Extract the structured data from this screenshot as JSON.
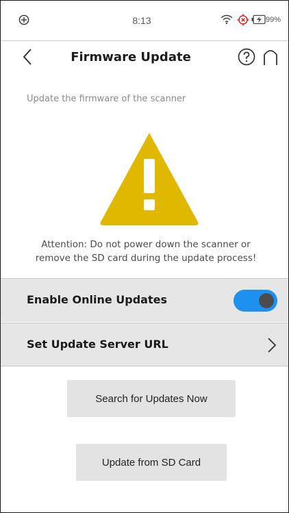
{
  "status_bar": {
    "time": "8:13",
    "battery_percent": "99%",
    "icons": [
      "app-logo-icon",
      "wifi-icon",
      "gps-target-icon",
      "battery-charging-icon"
    ]
  },
  "header": {
    "title": "Firmware Update",
    "icons": [
      "back-arrow-icon",
      "help-icon",
      "home-icon"
    ]
  },
  "subtitle": "Update the firmware of the scanner",
  "warning": {
    "icon": "warning-triangle-icon",
    "color": "#e0b800",
    "line1": "Attention: Do not power down the scanner or",
    "line2": "remove the SD card during the update process!"
  },
  "settings": {
    "online_updates": {
      "label": "Enable Online Updates",
      "enabled": true,
      "toggle_color": "#1e90ee"
    },
    "server_url": {
      "label": "Set Update Server URL",
      "icon": "chevron-right-icon"
    }
  },
  "buttons": {
    "search_now": "Search for Updates Now",
    "from_sd": "Update from SD Card"
  }
}
